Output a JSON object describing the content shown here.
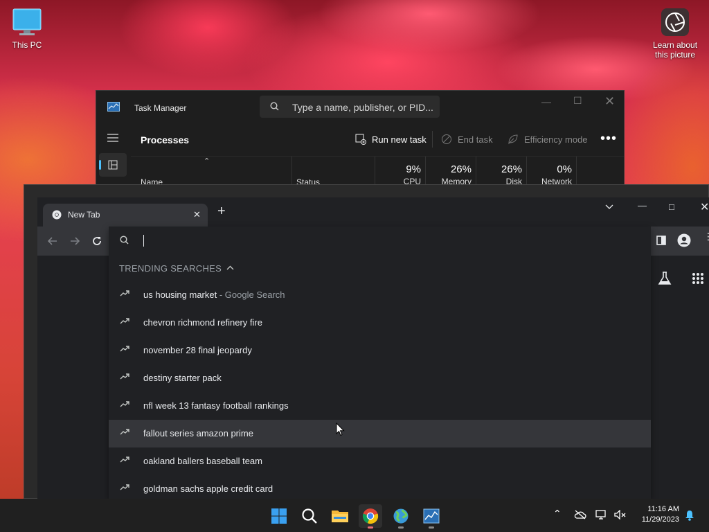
{
  "desktop": {
    "this_pc_label": "This PC",
    "learn_label_line1": "Learn about",
    "learn_label_line2": "this picture"
  },
  "task_manager": {
    "title": "Task Manager",
    "search_placeholder": "Type a name, publisher, or PID...",
    "page_title": "Processes",
    "run_new_task": "Run new task",
    "end_task": "End task",
    "efficiency_mode": "Efficiency mode",
    "columns": {
      "name": "Name",
      "status": "Status",
      "cpu_pct": "9%",
      "cpu": "CPU",
      "memory_pct": "26%",
      "memory": "Memory",
      "disk_pct": "26%",
      "disk": "Disk",
      "network_pct": "0%",
      "network": "Network"
    }
  },
  "chrome": {
    "tab_title": "New Tab",
    "omnibox_value": "",
    "trending_header": "TRENDING SEARCHES",
    "suggestions": [
      {
        "text": "us housing market",
        "detail": " - Google Search"
      },
      {
        "text": "chevron richmond refinery fire",
        "detail": ""
      },
      {
        "text": "november 28 final jeopardy",
        "detail": ""
      },
      {
        "text": "destiny starter pack",
        "detail": ""
      },
      {
        "text": "nfl week 13 fantasy football rankings",
        "detail": ""
      },
      {
        "text": "fallout series amazon prime",
        "detail": ""
      },
      {
        "text": "oakland ballers baseball team",
        "detail": ""
      },
      {
        "text": "goldman sachs apple credit card",
        "detail": ""
      }
    ]
  },
  "taskbar": {
    "time": "11:16 AM",
    "date": "11/29/2023"
  },
  "colors": {
    "accent": "#4cc2ff",
    "omnibox_bg": "#202124",
    "highlight": "#35363a"
  }
}
